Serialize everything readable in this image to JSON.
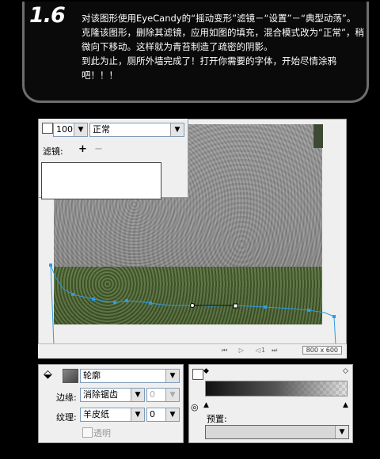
{
  "header": {
    "step": "1.6",
    "lines": [
      "对该图形使用EyeCandy的“摇动变形”滤镜－“设置”－“典型动荡”。",
      "克隆该图形，删除其滤镜，应用如图的填充，混合模式改为“正常”，稍微向下移动。这样就为青苔制造了疏密的阴影。",
      "到此为止，厕所外墙完成了！打开你需要的字体，开始尽情涂鸦吧！！！"
    ]
  },
  "layers": {
    "opacity": "100",
    "blend_mode": "正常",
    "filters_label": "滤镜:",
    "add": "+",
    "remove": "−"
  },
  "status": {
    "nav_icons": "⏮ ▷ ◁ ⏭",
    "page": "1",
    "dimensions": "800 x 600"
  },
  "fill": {
    "type": "轮廓",
    "edge_label": "边缘:",
    "edge_value": "消除锯齿",
    "edge_num": "0",
    "texture_label": "纹理:",
    "texture_value": "羊皮纸",
    "texture_num": "0",
    "transparent_label": "透明"
  },
  "gradient": {
    "preset_label": "预置:"
  }
}
